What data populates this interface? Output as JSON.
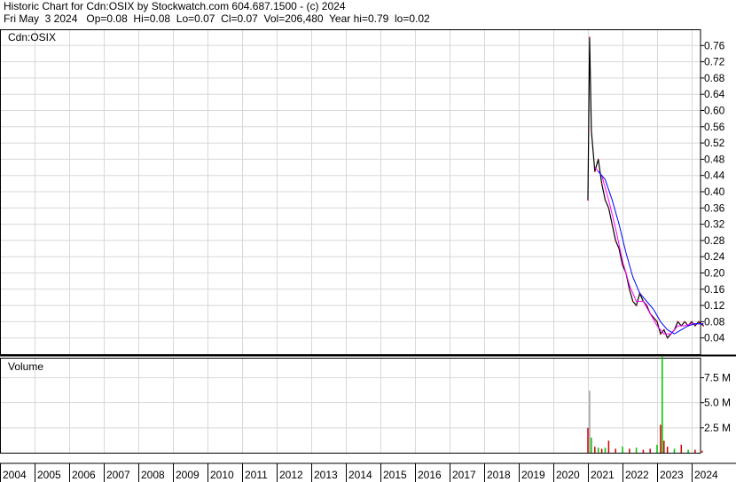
{
  "header": {
    "line1": "Historic Chart for Cdn:OSIX by Stockwatch.com 604.687.1500 - (c) 2024",
    "line2": "Fri May  3 2024   Op=0.08  Hi=0.08  Lo=0.07  Cl=0.07  Vol=206,480  Year hi=0.79  lo=0.02"
  },
  "chart_data": {
    "type": "line",
    "symbol": "Cdn:OSIX",
    "volume_label": "Volume",
    "price_yticks": [
      "0.76",
      "0.72",
      "0.68",
      "0.64",
      "0.60",
      "0.56",
      "0.52",
      "0.48",
      "0.44",
      "0.40",
      "0.36",
      "0.32",
      "0.28",
      "0.24",
      "0.20",
      "0.16",
      "0.12",
      "0.08",
      "0.04"
    ],
    "volume_yticks": [
      "7.5 M",
      "5.0 M",
      "2.5 M"
    ],
    "x_years": [
      "2004",
      "2005",
      "2006",
      "2007",
      "2008",
      "2009",
      "2010",
      "2011",
      "2012",
      "2013",
      "2014",
      "2015",
      "2016",
      "2017",
      "2018",
      "2019",
      "2020",
      "2021",
      "2022",
      "2023",
      "2024"
    ],
    "ylim": [
      0,
      0.8
    ],
    "volume_ylim": [
      0,
      9.5
    ],
    "grid": true,
    "series": [
      {
        "name": "",
        "color": "#000000",
        "x": [
          2021.0,
          2021.05,
          2021.1,
          2021.2,
          2021.3,
          2021.4,
          2021.5,
          2021.6,
          2021.7,
          2021.8,
          2021.9,
          2022.0,
          2022.1,
          2022.2,
          2022.3,
          2022.4,
          2022.5,
          2022.6,
          2022.7,
          2022.8,
          2022.9,
          2023.0,
          2023.1,
          2023.2,
          2023.3,
          2023.4,
          2023.5,
          2023.6,
          2023.7,
          2023.8,
          2023.9,
          2024.0,
          2024.1,
          2024.2,
          2024.34
        ],
        "values": [
          0.38,
          0.78,
          0.55,
          0.45,
          0.48,
          0.42,
          0.38,
          0.36,
          0.32,
          0.28,
          0.26,
          0.22,
          0.2,
          0.16,
          0.13,
          0.12,
          0.15,
          0.13,
          0.12,
          0.1,
          0.09,
          0.08,
          0.05,
          0.06,
          0.04,
          0.05,
          0.06,
          0.08,
          0.07,
          0.08,
          0.07,
          0.08,
          0.07,
          0.08,
          0.07
        ]
      },
      {
        "name": "",
        "color": "#ff00ff",
        "x": [
          2021.2,
          2021.4,
          2021.6,
          2021.8,
          2022.0,
          2022.2,
          2022.4,
          2022.6,
          2022.8,
          2023.0,
          2023.2,
          2023.4,
          2023.6,
          2023.8,
          2024.0,
          2024.34
        ],
        "values": [
          0.46,
          0.44,
          0.38,
          0.31,
          0.23,
          0.17,
          0.13,
          0.13,
          0.1,
          0.07,
          0.05,
          0.05,
          0.07,
          0.07,
          0.075,
          0.075
        ]
      },
      {
        "name": "",
        "color": "#0000ff",
        "x": [
          2021.3,
          2021.5,
          2021.7,
          2021.9,
          2022.1,
          2022.3,
          2022.5,
          2022.7,
          2022.9,
          2023.1,
          2023.3,
          2023.5,
          2023.7,
          2023.9,
          2024.1,
          2024.34
        ],
        "values": [
          0.45,
          0.43,
          0.38,
          0.32,
          0.25,
          0.19,
          0.15,
          0.13,
          0.11,
          0.08,
          0.06,
          0.05,
          0.06,
          0.07,
          0.075,
          0.075
        ]
      }
    ],
    "volume": {
      "x": [
        2021.0,
        2021.05,
        2021.1,
        2021.2,
        2021.3,
        2021.4,
        2021.5,
        2021.6,
        2021.8,
        2022.0,
        2022.2,
        2022.4,
        2022.6,
        2022.8,
        2023.0,
        2023.1,
        2023.15,
        2023.2,
        2023.3,
        2023.5,
        2023.7,
        2023.9,
        2024.1,
        2024.3
      ],
      "values": [
        2.5,
        6.2,
        1.5,
        0.6,
        0.5,
        0.4,
        0.5,
        1.2,
        0.4,
        0.6,
        0.4,
        0.5,
        0.3,
        0.4,
        0.8,
        2.8,
        9.6,
        1.2,
        0.6,
        0.4,
        0.8,
        0.3,
        0.3,
        0.2
      ],
      "colors": [
        "#d00000",
        "#a0a0a0",
        "#00c000",
        "#d00000",
        "#00c000",
        "#d00000",
        "#00c000",
        "#d00000",
        "#d00000",
        "#00c000",
        "#d00000",
        "#00c000",
        "#d00000",
        "#d00000",
        "#00c000",
        "#d00000",
        "#00c000",
        "#d00000",
        "#d00000",
        "#00c000",
        "#d00000",
        "#00c000",
        "#d00000",
        "#d00000"
      ]
    }
  }
}
